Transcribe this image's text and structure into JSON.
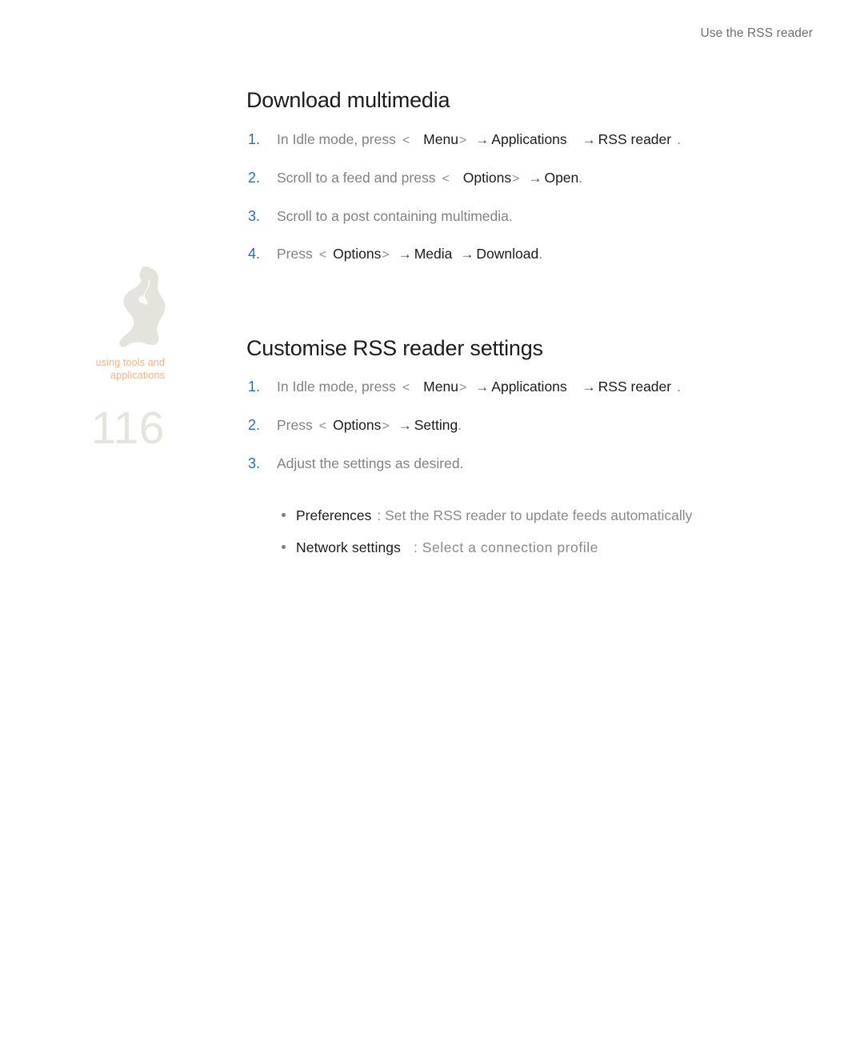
{
  "header": {
    "running_title": "Use the RSS reader"
  },
  "sidebar": {
    "chapter_label_line1": "using tools and",
    "chapter_label_line2": "applications",
    "page_number": "116",
    "artwork_name": "person-with-headphones-silhouette",
    "colors": {
      "chapter_label": "#f6b388",
      "page_number": "#e6e5dd",
      "artwork": "#e4e4dc"
    }
  },
  "colors": {
    "step_number": "#2271b3",
    "body_text": "#777777",
    "emphasis_text": "#1b1b1b",
    "header_text": "#6f6f6f"
  },
  "sections": [
    {
      "title": "Download multimedia",
      "steps": [
        {
          "number": "1.",
          "parts": [
            {
              "text": "In Idle mode, press",
              "style": "gray"
            },
            {
              "text": "<",
              "style": "bracket"
            },
            {
              "text": "Menu",
              "style": "dark"
            },
            {
              "text": ">",
              "style": "bracket"
            },
            {
              "text": "→",
              "style": "arrow"
            },
            {
              "text": "Applications",
              "style": "dark"
            },
            {
              "text": "→",
              "style": "arrow"
            },
            {
              "text": "RSS reader",
              "style": "dark"
            },
            {
              "text": ".",
              "style": "gray"
            }
          ]
        },
        {
          "number": "2.",
          "parts": [
            {
              "text": "Scroll to a feed and press",
              "style": "gray"
            },
            {
              "text": "<",
              "style": "bracket"
            },
            {
              "text": "Options",
              "style": "dark"
            },
            {
              "text": ">",
              "style": "bracket"
            },
            {
              "text": "→",
              "style": "arrow"
            },
            {
              "text": "Open",
              "style": "dark"
            },
            {
              "text": ".",
              "style": "gray"
            }
          ]
        },
        {
          "number": "3.",
          "parts": [
            {
              "text": "Scroll to a post containing multimedia.",
              "style": "gray"
            }
          ]
        },
        {
          "number": "4.",
          "parts": [
            {
              "text": "Press",
              "style": "gray"
            },
            {
              "text": "<",
              "style": "bracket"
            },
            {
              "text": "Options",
              "style": "dark"
            },
            {
              "text": ">",
              "style": "bracket"
            },
            {
              "text": "→",
              "style": "arrow"
            },
            {
              "text": "Media",
              "style": "dark"
            },
            {
              "text": "→",
              "style": "arrow"
            },
            {
              "text": "Download",
              "style": "dark"
            },
            {
              "text": ".",
              "style": "gray"
            }
          ]
        }
      ]
    },
    {
      "title": "Customise RSS reader settings",
      "steps": [
        {
          "number": "1.",
          "parts": [
            {
              "text": "In Idle mode, press",
              "style": "gray"
            },
            {
              "text": "<",
              "style": "bracket"
            },
            {
              "text": "Menu",
              "style": "dark"
            },
            {
              "text": ">",
              "style": "bracket"
            },
            {
              "text": "→",
              "style": "arrow"
            },
            {
              "text": "Applications",
              "style": "dark"
            },
            {
              "text": "→",
              "style": "arrow"
            },
            {
              "text": "RSS reader",
              "style": "dark"
            },
            {
              "text": ".",
              "style": "gray"
            }
          ]
        },
        {
          "number": "2.",
          "parts": [
            {
              "text": "Press",
              "style": "gray"
            },
            {
              "text": "<",
              "style": "bracket"
            },
            {
              "text": "Options",
              "style": "dark"
            },
            {
              "text": ">",
              "style": "bracket"
            },
            {
              "text": "→",
              "style": "arrow"
            },
            {
              "text": "Setting",
              "style": "dark"
            },
            {
              "text": ".",
              "style": "gray"
            }
          ]
        },
        {
          "number": "3.",
          "parts": [
            {
              "text": "Adjust the settings as desired.",
              "style": "gray"
            }
          ]
        }
      ],
      "bullets": [
        {
          "term": "Preferences",
          "separator": ":",
          "description": "Set the RSS reader to update feeds automatically"
        },
        {
          "term": "Network settings",
          "separator": ":",
          "description": "Select a connection profile"
        }
      ]
    }
  ],
  "steps_1": {
    "s1": {
      "p0": "In Idle mode, press",
      "p1": "<",
      "p2": "Menu",
      "p3": ">",
      "p4": "→",
      "p5": "Applications",
      "p6": "→",
      "p7": "RSS reader",
      "p8": "."
    },
    "s2": {
      "p0": "Scroll to a feed and press",
      "p1": "<",
      "p2": "Options",
      "p3": ">",
      "p4": "→",
      "p5": "Open",
      "p6": "."
    },
    "s3": {
      "p0": "Scroll to a post containing multimedia."
    },
    "s4": {
      "p0": "Press",
      "p1": "<",
      "p2": "Options",
      "p3": ">",
      "p4": "→",
      "p5": "Media",
      "p6": "→",
      "p7": "Download",
      "p8": "."
    }
  },
  "steps_2": {
    "s1": {
      "p0": "In Idle mode, press",
      "p1": "<",
      "p2": "Menu",
      "p3": ">",
      "p4": "→",
      "p5": "Applications",
      "p6": "→",
      "p7": "RSS reader",
      "p8": "."
    },
    "s2": {
      "p0": "Press",
      "p1": "<",
      "p2": "Options",
      "p3": ">",
      "p4": "→",
      "p5": "Setting",
      "p6": "."
    },
    "s3": {
      "p0": "Adjust the settings as desired."
    }
  },
  "step_numbers": {
    "n1": "1.",
    "n2": "2.",
    "n3": "3.",
    "n4": "4."
  }
}
